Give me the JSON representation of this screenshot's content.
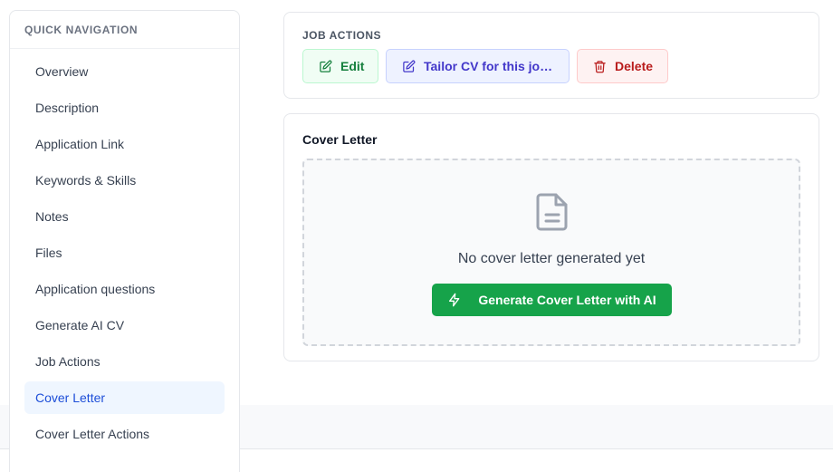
{
  "sidebar": {
    "header": "QUICK NAVIGATION",
    "items": [
      {
        "label": "Overview"
      },
      {
        "label": "Description"
      },
      {
        "label": "Application Link"
      },
      {
        "label": "Keywords & Skills"
      },
      {
        "label": "Notes"
      },
      {
        "label": "Files"
      },
      {
        "label": "Application questions"
      },
      {
        "label": "Generate AI CV"
      },
      {
        "label": "Job Actions"
      },
      {
        "label": "Cover Letter",
        "active": true
      },
      {
        "label": "Cover Letter Actions"
      }
    ]
  },
  "job_actions": {
    "title": "JOB ACTIONS",
    "edit_label": "Edit",
    "tailor_label": "Tailor CV for this job...",
    "delete_label": "Delete",
    "icons": {
      "edit": "edit-icon",
      "tailor": "edit-icon",
      "delete": "trash-icon"
    }
  },
  "cover_letter": {
    "title": "Cover Letter",
    "empty_text": "No cover letter generated yet",
    "generate_label": "Generate Cover Letter with AI",
    "icons": {
      "empty": "document-icon",
      "generate": "lightning-icon"
    }
  },
  "colors": {
    "accent_blue": "#1d4ed8",
    "active_bg": "#eff6ff",
    "success": "#16a34a",
    "indigo": "#4338ca",
    "danger": "#b91c1c"
  }
}
